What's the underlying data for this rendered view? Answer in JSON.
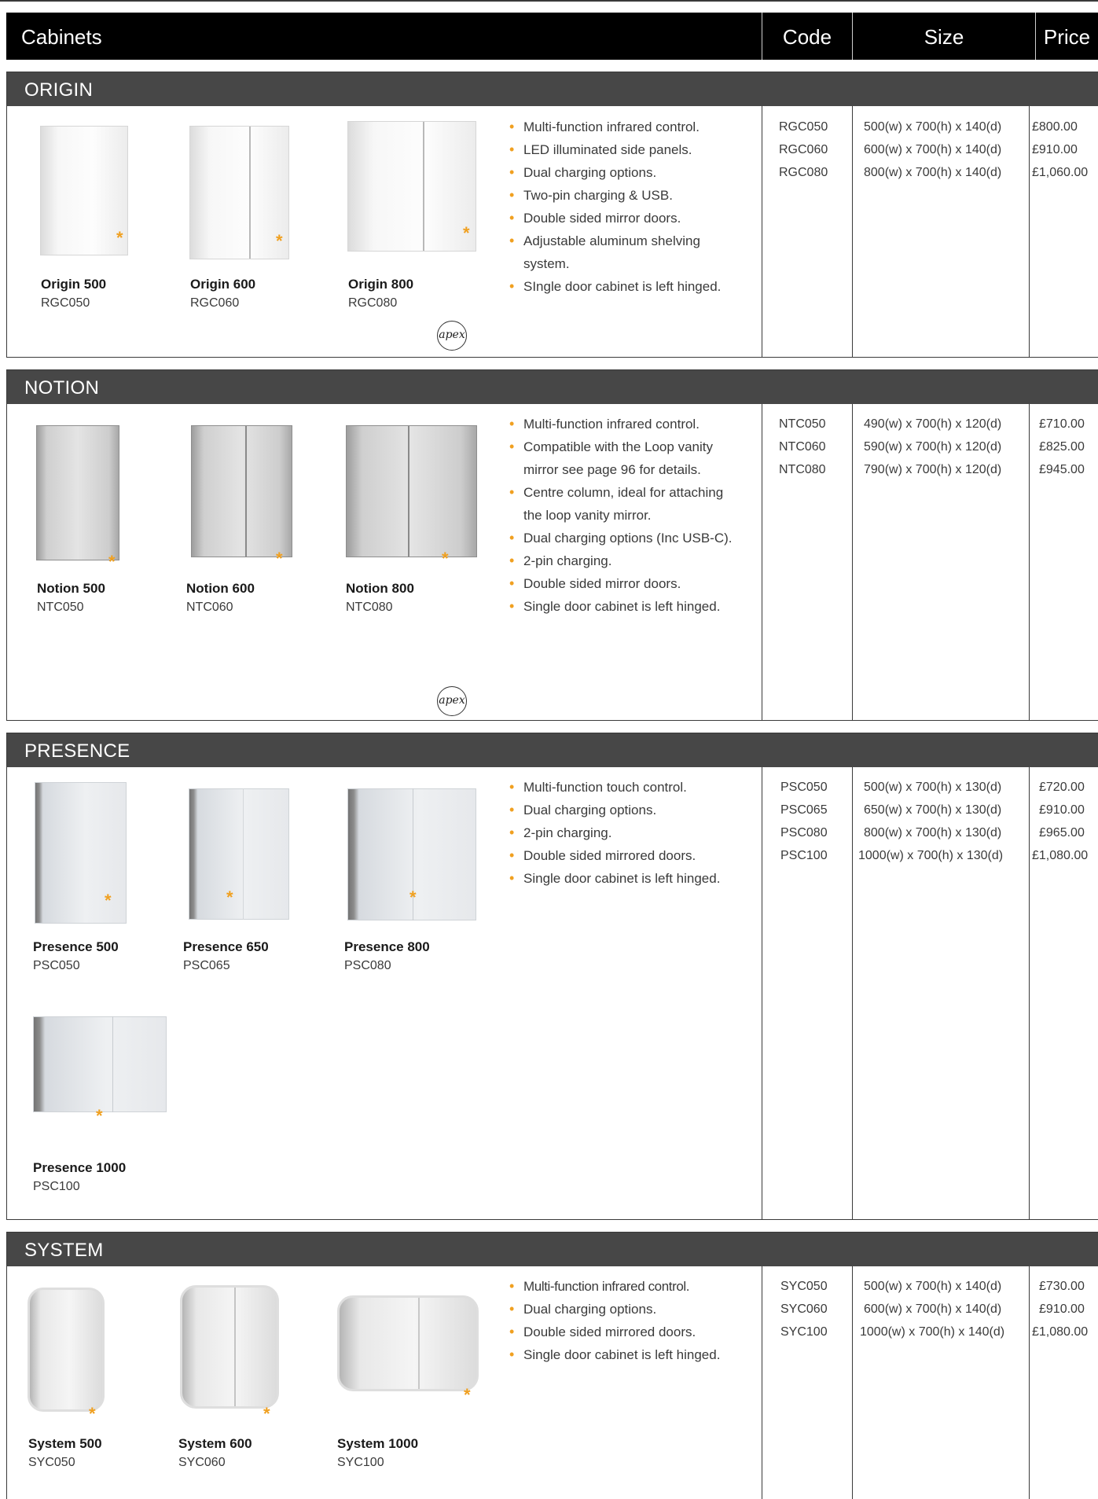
{
  "header": {
    "title": "Cabinets",
    "code": "Code",
    "size": "Size",
    "price": "Price"
  },
  "sections": [
    {
      "name": "ORIGIN",
      "products": [
        {
          "name": "Origin 500",
          "code": "RGC050"
        },
        {
          "name": "Origin 600",
          "code": "RGC060"
        },
        {
          "name": "Origin 800",
          "code": "RGC080"
        }
      ],
      "features": [
        "Multi-function infrared control.",
        "LED illuminated side panels.",
        "Dual charging options.",
        "Two-pin charging & USB.",
        "Double sided mirror doors.",
        "Adjustable aluminum shelving system.",
        "SIngle door cabinet is left hinged."
      ],
      "codes": [
        "RGC050",
        "RGC060",
        "RGC080"
      ],
      "sizes": [
        "500(w) x 700(h) x 140(d)",
        "600(w) x 700(h) x 140(d)",
        "800(w) x 700(h) x 140(d)"
      ],
      "prices": [
        "£800.00",
        "£910.00",
        "£1,060.00"
      ],
      "logo": "apex"
    },
    {
      "name": "NOTION",
      "products": [
        {
          "name": "Notion 500",
          "code": "NTC050"
        },
        {
          "name": "Notion 600",
          "code": "NTC060"
        },
        {
          "name": "Notion 800",
          "code": "NTC080"
        }
      ],
      "features": [
        "Multi-function infrared control.",
        "Compatible with the Loop vanity mirror see page 96 for details.",
        "Centre column, ideal for attaching the loop vanity mirror.",
        "Dual charging options (Inc USB-C).",
        "2-pin charging.",
        "Double sided mirror doors.",
        "Single door cabinet is left hinged."
      ],
      "codes": [
        "NTC050",
        "NTC060",
        "NTC080"
      ],
      "sizes": [
        "490(w) x 700(h) x 120(d)",
        "590(w) x 700(h) x 120(d)",
        "790(w) x 700(h) x 120(d)"
      ],
      "prices": [
        "£710.00",
        "£825.00",
        "£945.00"
      ],
      "logo": "apex"
    },
    {
      "name": "PRESENCE",
      "products": [
        {
          "name": "Presence 500",
          "code": "PSC050"
        },
        {
          "name": "Presence 650",
          "code": "PSC065"
        },
        {
          "name": "Presence 800",
          "code": "PSC080"
        },
        {
          "name": "Presence 1000",
          "code": "PSC100"
        }
      ],
      "features": [
        "Multi-function touch control.",
        "Dual charging options.",
        "2-pin charging.",
        "Double sided mirrored doors.",
        "Single door cabinet is left hinged."
      ],
      "codes": [
        "PSC050",
        "PSC065",
        "PSC080",
        "PSC100"
      ],
      "sizes": [
        "500(w) x 700(h) x 130(d)",
        "650(w) x 700(h) x 130(d)",
        "800(w) x 700(h) x 130(d)",
        "1000(w) x 700(h) x 130(d)"
      ],
      "prices": [
        "£720.00",
        "£910.00",
        "£965.00",
        "£1,080.00"
      ]
    },
    {
      "name": "SYSTEM",
      "products": [
        {
          "name": "System 500",
          "code": "SYC050"
        },
        {
          "name": "System 600",
          "code": "SYC060"
        },
        {
          "name": "System 1000",
          "code": "SYC100"
        }
      ],
      "features": [
        "Multi-function infrared control.",
        "Dual charging options.",
        "Double sided mirrored doors.",
        "Single door cabinet is left hinged."
      ],
      "codes": [
        "SYC050",
        "SYC060",
        "SYC100"
      ],
      "sizes": [
        "500(w) x 700(h) x 140(d)",
        "600(w) x 700(h) x 140(d)",
        "1000(w) x 700(h) x 140(d)"
      ],
      "prices": [
        "£730.00",
        "£910.00",
        "£1,080.00"
      ]
    }
  ]
}
